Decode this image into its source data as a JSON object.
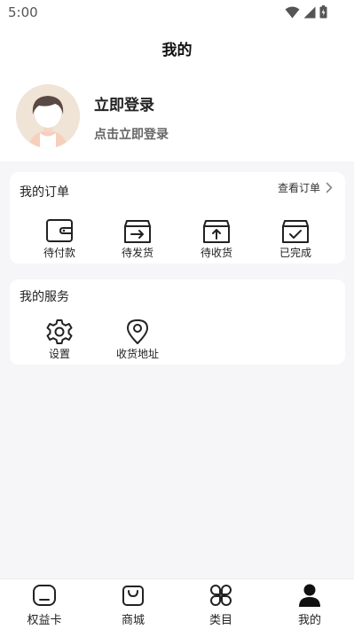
{
  "status_bar": {
    "time": "5:00",
    "icons": [
      "wifi-icon",
      "signal-icon",
      "battery-icon"
    ]
  },
  "header": {
    "title": "我的"
  },
  "profile": {
    "login_title": "立即登录",
    "login_subtitle": "点击立即登录",
    "avatar_icon": "default-avatar"
  },
  "orders": {
    "title": "我的订单",
    "view_all_label": "查看订单",
    "items": [
      {
        "label": "待付款",
        "icon": "wallet-icon"
      },
      {
        "label": "待发货",
        "icon": "box-arrow-right-icon"
      },
      {
        "label": "待收货",
        "icon": "box-arrow-up-icon"
      },
      {
        "label": "已完成",
        "icon": "box-check-icon"
      }
    ]
  },
  "services": {
    "title": "我的服务",
    "items": [
      {
        "label": "设置",
        "icon": "gear-icon"
      },
      {
        "label": "收货地址",
        "icon": "location-pin-icon"
      }
    ]
  },
  "bottom_nav": {
    "tabs": [
      {
        "label": "权益卡",
        "icon": "card-icon",
        "active": false
      },
      {
        "label": "商城",
        "icon": "shopping-bag-icon",
        "active": false
      },
      {
        "label": "类目",
        "icon": "category-icon",
        "active": false
      },
      {
        "label": "我的",
        "icon": "person-icon",
        "active": true
      }
    ]
  },
  "colors": {
    "background": "#f6f6f8",
    "card": "#ffffff",
    "text": "#222222",
    "subtext": "#666666",
    "avatar_bg": "#efe4d6"
  }
}
